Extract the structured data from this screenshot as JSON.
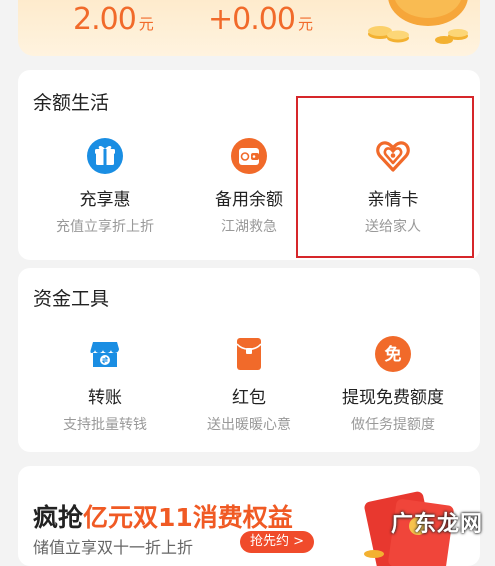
{
  "balance": {
    "left_amount": "2.00",
    "left_unit": "元",
    "right_amount": "+0.00",
    "right_unit": "元"
  },
  "life_section": {
    "title": "余额生活",
    "items": [
      {
        "label": "充享惠",
        "sub": "充值立享折上折",
        "icon": "gift-box-icon"
      },
      {
        "label": "备用余额",
        "sub": "江湖救急",
        "icon": "wallet-icon"
      },
      {
        "label": "亲情卡",
        "sub": "送给家人",
        "icon": "heart-card-icon"
      }
    ]
  },
  "tools_section": {
    "title": "资金工具",
    "items": [
      {
        "label": "转账",
        "sub": "支持批量转钱",
        "icon": "transfer-icon"
      },
      {
        "label": "红包",
        "sub": "送出暖暖心意",
        "icon": "red-packet-icon"
      },
      {
        "label": "提现免费额度",
        "sub": "做任务提额度",
        "icon": "free-withdraw-icon",
        "glyph": "免"
      }
    ]
  },
  "promo": {
    "title_prefix": "疯抢",
    "title_accent": "亿元双11消费权益",
    "sub": "储值立享双十一折上折",
    "button": "抢先约 >"
  },
  "watermark": "广东龙网",
  "colors": {
    "accent_orange": "#f16a2a",
    "icon_blue": "#1a8ee3",
    "highlight_red": "#d6262a",
    "promo_button": "#f04b2b"
  }
}
